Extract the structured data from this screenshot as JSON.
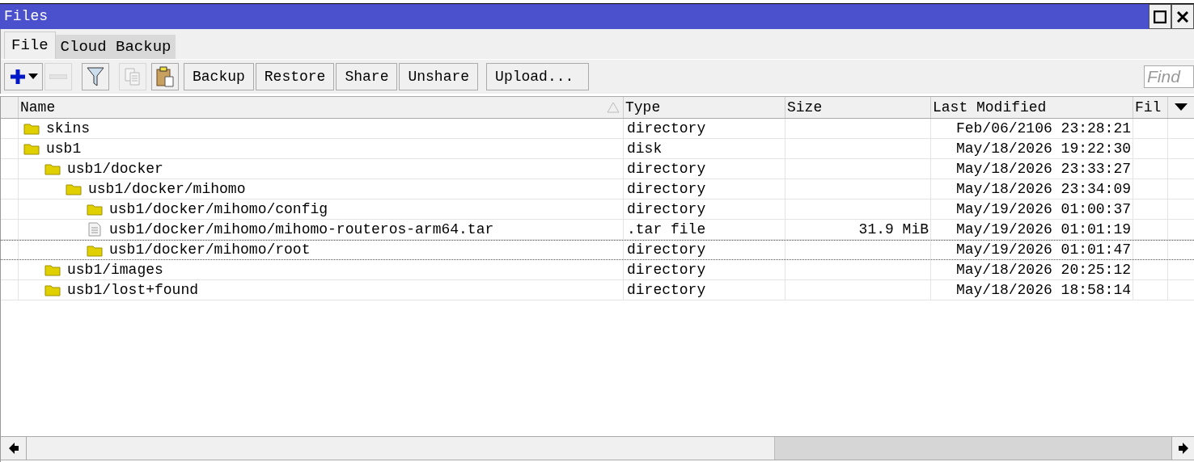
{
  "window": {
    "title": "Files"
  },
  "tabs": [
    {
      "label": "File",
      "selected": true
    },
    {
      "label": "Cloud Backup",
      "selected": false
    }
  ],
  "toolbar": {
    "icons": [
      {
        "kind": "add",
        "disabled": false
      },
      {
        "kind": "remove",
        "disabled": true
      },
      {
        "kind": "filter",
        "disabled": false
      },
      {
        "kind": "copy",
        "disabled": true
      },
      {
        "kind": "paste",
        "disabled": false
      }
    ],
    "buttons": [
      "Backup",
      "Restore",
      "Share",
      "Unshare",
      "Upload..."
    ]
  },
  "search": {
    "placeholder": "Find"
  },
  "table": {
    "columns": [
      {
        "label": "Name",
        "sorted": true
      },
      {
        "label": "Type",
        "sorted": false
      },
      {
        "label": "Size",
        "sorted": false
      },
      {
        "label": "Last Modified",
        "sorted": false
      },
      {
        "label": "Fil",
        "sorted": false
      }
    ],
    "rows": [
      {
        "name": "skins",
        "kind": "folder",
        "type": "directory",
        "modified": "Feb/06/2106 23:28:21",
        "selected": false
      },
      {
        "name": "usb1",
        "kind": "folder",
        "type": "disk",
        "modified": "May/18/2026 19:22:30",
        "selected": false,
        "children": [
          {
            "name": "usb1/docker",
            "kind": "folder",
            "type": "directory",
            "modified": "May/18/2026 23:33:27",
            "selected": false,
            "children": [
              {
                "name": "usb1/docker/mihomo",
                "kind": "folder",
                "type": "directory",
                "modified": "May/18/2026 23:34:09",
                "selected": false,
                "children": [
                  {
                    "name": "usb1/docker/mihomo/config",
                    "kind": "folder",
                    "type": "directory",
                    "modified": "May/19/2026 01:00:37",
                    "selected": false
                  },
                  {
                    "name": "usb1/docker/mihomo/mihomo-routeros-arm64.tar",
                    "kind": "file",
                    "type": ".tar file",
                    "size": "31.9 MiB",
                    "modified": "May/19/2026 01:01:19",
                    "selected": false
                  },
                  {
                    "name": "usb1/docker/mihomo/root",
                    "kind": "folder",
                    "type": "directory",
                    "modified": "May/19/2026 01:01:47",
                    "selected": true
                  }
                ]
              }
            ]
          },
          {
            "name": "usb1/images",
            "kind": "folder",
            "type": "directory",
            "modified": "May/18/2026 20:25:12",
            "selected": false
          },
          {
            "name": "usb1/lost+found",
            "kind": "folder",
            "type": "directory",
            "modified": "May/18/2026 18:58:14",
            "selected": false
          }
        ]
      }
    ]
  }
}
